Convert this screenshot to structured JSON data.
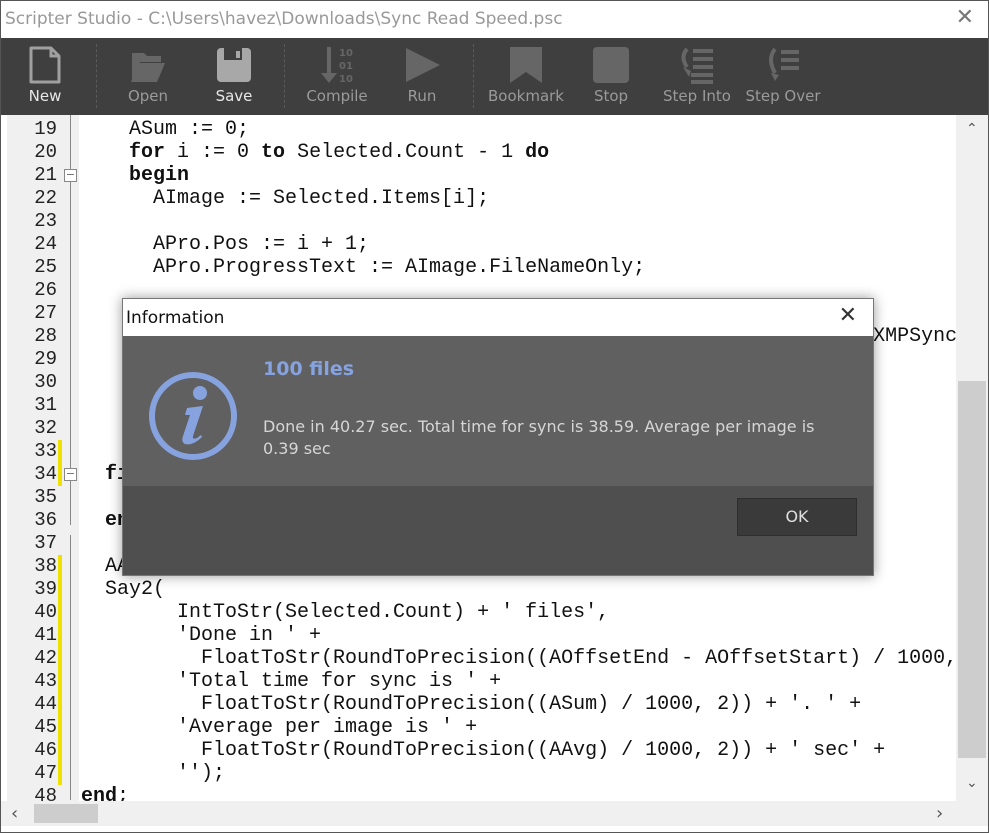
{
  "window": {
    "title": "Scripter Studio - C:\\Users\\havez\\Downloads\\Sync Read Speed.psc",
    "close": "✕"
  },
  "toolbar": [
    {
      "label": "New",
      "icon": "new-file-icon",
      "enabled": true
    },
    {
      "label": "Open",
      "icon": "folder-open-icon",
      "enabled": false
    },
    {
      "label": "Save",
      "icon": "floppy-disk-icon",
      "enabled": true
    },
    {
      "label": "Compile",
      "icon": "compile-binary-icon",
      "enabled": false
    },
    {
      "label": "Run",
      "icon": "play-icon",
      "enabled": false
    },
    {
      "label": "Bookmark",
      "icon": "bookmark-icon",
      "enabled": false
    },
    {
      "label": "Stop",
      "icon": "stop-icon",
      "enabled": false
    },
    {
      "label": "Step Into",
      "icon": "step-into-icon",
      "enabled": false
    },
    {
      "label": "Step Over",
      "icon": "step-over-icon",
      "enabled": false
    }
  ],
  "editor": {
    "modified_lines": [
      "33",
      "34",
      "38",
      "39",
      "40",
      "41",
      "42",
      "43",
      "44",
      "45",
      "46",
      "47"
    ],
    "fold_markers": [
      "21",
      "34"
    ],
    "lines": [
      {
        "n": "19",
        "seg": [
          [
            "    ASum := 0;",
            0
          ]
        ]
      },
      {
        "n": "20",
        "seg": [
          [
            "    ",
            0
          ],
          [
            "for",
            1
          ],
          [
            " i := 0 ",
            0
          ],
          [
            "to",
            1
          ],
          [
            " Selected.Count - 1 ",
            0
          ],
          [
            "do",
            1
          ]
        ]
      },
      {
        "n": "21",
        "seg": [
          [
            "    ",
            0
          ],
          [
            "begin",
            1
          ]
        ]
      },
      {
        "n": "22",
        "seg": [
          [
            "      AImage := Selected.Items[i];",
            0
          ]
        ]
      },
      {
        "n": "23",
        "seg": []
      },
      {
        "n": "24",
        "seg": [
          [
            "      APro.Pos := i + 1;",
            0
          ]
        ]
      },
      {
        "n": "25",
        "seg": [
          [
            "      APro.ProgressText := AImage.FileNameOnly;",
            0
          ]
        ]
      },
      {
        "n": "26",
        "seg": []
      },
      {
        "n": "27",
        "seg": []
      },
      {
        "n": "28",
        "seg": [
          [
            "                                                                  XMPSync",
            0
          ]
        ]
      },
      {
        "n": "29",
        "seg": []
      },
      {
        "n": "30",
        "seg": []
      },
      {
        "n": "31",
        "seg": []
      },
      {
        "n": "32",
        "seg": []
      },
      {
        "n": "33",
        "seg": []
      },
      {
        "n": "34",
        "seg": [
          [
            "  ",
            0
          ],
          [
            "fi",
            1
          ]
        ]
      },
      {
        "n": "35",
        "seg": []
      },
      {
        "n": "36",
        "seg": [
          [
            "  ",
            0
          ],
          [
            "en",
            1
          ]
        ]
      },
      {
        "n": "37",
        "seg": []
      },
      {
        "n": "38",
        "seg": [
          [
            "  AA",
            0
          ]
        ]
      },
      {
        "n": "39",
        "seg": [
          [
            "  Say2(",
            0
          ]
        ]
      },
      {
        "n": "40",
        "seg": [
          [
            "        IntToStr(Selected.Count) + ' files',",
            0
          ]
        ]
      },
      {
        "n": "41",
        "seg": [
          [
            "        'Done in ' +",
            0
          ]
        ]
      },
      {
        "n": "42",
        "seg": [
          [
            "          FloatToStr(RoundToPrecision((AOffsetEnd - AOffsetStart) / 1000,",
            0
          ]
        ]
      },
      {
        "n": "43",
        "seg": [
          [
            "        'Total time for sync is ' +",
            0
          ]
        ]
      },
      {
        "n": "44",
        "seg": [
          [
            "          FloatToStr(RoundToPrecision((ASum) / 1000, 2)) + '. ' +",
            0
          ]
        ]
      },
      {
        "n": "45",
        "seg": [
          [
            "        'Average per image is ' +",
            0
          ]
        ]
      },
      {
        "n": "46",
        "seg": [
          [
            "          FloatToStr(RoundToPrecision((AAvg) / 1000, 2)) + ' sec' +",
            0
          ]
        ]
      },
      {
        "n": "47",
        "seg": [
          [
            "        '');",
            0
          ]
        ]
      },
      {
        "n": "48",
        "seg": [
          [
            "end",
            1
          ],
          [
            ";",
            0
          ]
        ]
      }
    ]
  },
  "dialog": {
    "title": "Information",
    "close": "✕",
    "heading": "100 files",
    "message": "Done in 40.27 sec. Total time for sync is 38.59. Average per image is 0.39 sec",
    "ok_label": "OK",
    "icon": "info-icon",
    "accent": "#86a3df"
  },
  "scrollbar": {
    "up": "⌃",
    "down": "⌄",
    "left": "‹",
    "right": "›"
  }
}
